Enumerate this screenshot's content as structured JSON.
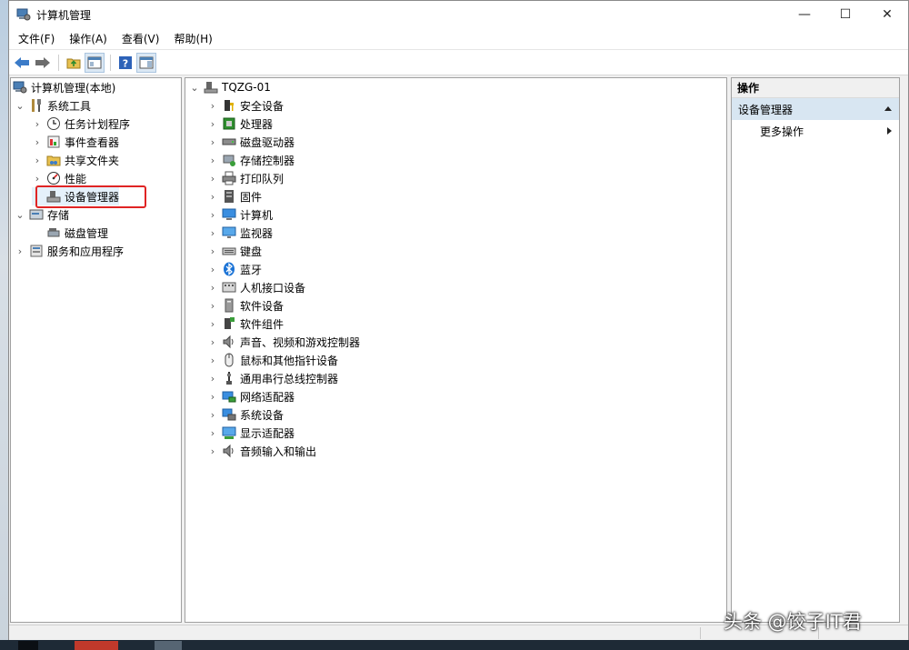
{
  "window": {
    "title": "计算机管理",
    "controls": {
      "minimize": "—",
      "maximize": "☐",
      "close": "✕"
    }
  },
  "menu": [
    "文件(F)",
    "操作(A)",
    "查看(V)",
    "帮助(H)"
  ],
  "toolbar": {
    "icons": [
      "back-arrow-icon",
      "forward-arrow-icon",
      "up-folder-icon",
      "console-tree-icon",
      "help-icon",
      "properties-icon"
    ]
  },
  "tree": {
    "root": "计算机管理(本地)",
    "items": [
      {
        "label": "系统工具",
        "level": 1,
        "expanded": true,
        "icon": "tools-icon"
      },
      {
        "label": "任务计划程序",
        "level": 2,
        "icon": "clock-icon"
      },
      {
        "label": "事件查看器",
        "level": 2,
        "icon": "event-viewer-icon"
      },
      {
        "label": "共享文件夹",
        "level": 2,
        "icon": "shared-folder-icon"
      },
      {
        "label": "性能",
        "level": 2,
        "icon": "performance-icon"
      },
      {
        "label": "设备管理器",
        "level": 2,
        "icon": "device-manager-icon",
        "selected": true
      },
      {
        "label": "存储",
        "level": 1,
        "expanded": true,
        "icon": "storage-icon"
      },
      {
        "label": "磁盘管理",
        "level": 2,
        "icon": "disk-management-icon"
      },
      {
        "label": "服务和应用程序",
        "level": 1,
        "icon": "services-icon"
      }
    ]
  },
  "devices": {
    "computer_name": "TQZG-01",
    "categories": [
      {
        "label": "安全设备",
        "icon": "security-device-icon"
      },
      {
        "label": "处理器",
        "icon": "processor-icon"
      },
      {
        "label": "磁盘驱动器",
        "icon": "disk-drive-icon"
      },
      {
        "label": "存储控制器",
        "icon": "storage-controller-icon"
      },
      {
        "label": "打印队列",
        "icon": "printer-icon"
      },
      {
        "label": "固件",
        "icon": "firmware-icon"
      },
      {
        "label": "计算机",
        "icon": "computer-icon"
      },
      {
        "label": "监视器",
        "icon": "monitor-icon"
      },
      {
        "label": "键盘",
        "icon": "keyboard-icon"
      },
      {
        "label": "蓝牙",
        "icon": "bluetooth-icon"
      },
      {
        "label": "人机接口设备",
        "icon": "hid-icon"
      },
      {
        "label": "软件设备",
        "icon": "software-device-icon"
      },
      {
        "label": "软件组件",
        "icon": "software-component-icon"
      },
      {
        "label": "声音、视频和游戏控制器",
        "icon": "audio-icon"
      },
      {
        "label": "鼠标和其他指针设备",
        "icon": "mouse-icon"
      },
      {
        "label": "通用串行总线控制器",
        "icon": "usb-icon"
      },
      {
        "label": "网络适配器",
        "icon": "network-adapter-icon"
      },
      {
        "label": "系统设备",
        "icon": "system-device-icon"
      },
      {
        "label": "显示适配器",
        "icon": "display-adapter-icon"
      },
      {
        "label": "音频输入和输出",
        "icon": "audio-io-icon"
      }
    ]
  },
  "actions": {
    "header": "操作",
    "section": "设备管理器",
    "more": "更多操作"
  },
  "watermark": "头条 @饺子IT君",
  "colors": {
    "selection": "#d8e6f2",
    "highlight_box": "#e02424"
  }
}
